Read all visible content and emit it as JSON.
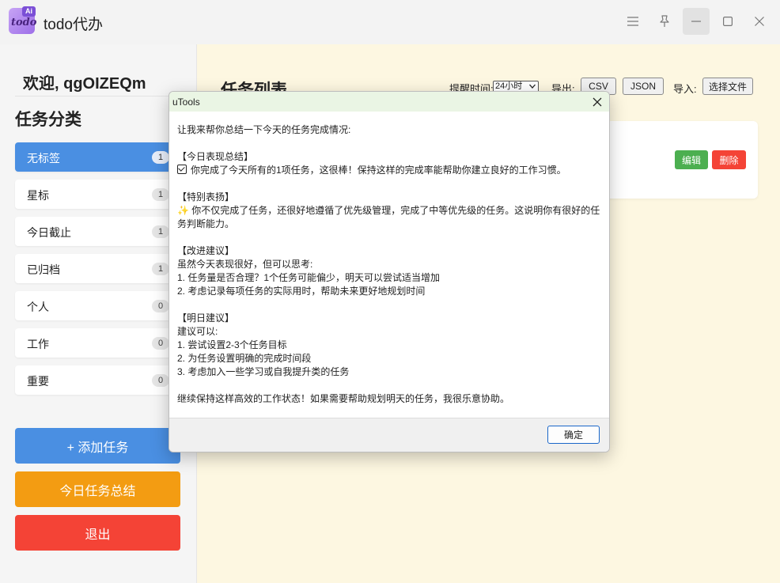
{
  "app": {
    "title": "todo代办",
    "logo_text": "todo",
    "logo_badge": "Ai",
    "window_controls": [
      "menu-icon",
      "pin-icon",
      "minimize-icon",
      "maximize-icon",
      "close-icon"
    ]
  },
  "sidebar": {
    "welcome": "欢迎, qgOIZEQm",
    "categories_heading": "任务分类",
    "categories": [
      {
        "label": "无标签",
        "count": "1",
        "active": true
      },
      {
        "label": "星标",
        "count": "1"
      },
      {
        "label": "今日截止",
        "count": "1"
      },
      {
        "label": "已归档",
        "count": "1"
      },
      {
        "label": "个人",
        "count": "0"
      },
      {
        "label": "工作",
        "count": "0"
      },
      {
        "label": "重要",
        "count": "0"
      }
    ],
    "add_task_label": "+ 添加任务",
    "summary_label": "今日任务总结",
    "logout_label": "退出",
    "colors": {
      "add": "#4a8fe2",
      "summary": "#f39c12",
      "logout": "#f44336",
      "active_category": "#4a8fe2"
    }
  },
  "main": {
    "title": "任务列表",
    "reminder_label": "提醒时间:",
    "reminder_value": "24小时",
    "export_label": "导出:",
    "export_csv": "CSV",
    "export_json": "JSON",
    "import_label": "导入:",
    "import_button": "选择文件",
    "task": {
      "edit_label": "编辑",
      "delete_label": "删除",
      "colors": {
        "edit": "#4caf50",
        "delete": "#f44336"
      }
    }
  },
  "dialog": {
    "title": "uTools",
    "lines": [
      {
        "text": "让我来帮你总结一下今天的任务完成情况:"
      },
      {
        "gap": true
      },
      {
        "text": "【今日表现总结】"
      },
      {
        "text": "你完成了今天所有的1项任务，这很棒！保持这样的完成率能帮助你建立良好的工作习惯。",
        "icon": "checkbox"
      },
      {
        "gap": true
      },
      {
        "text": "【特别表扬】"
      },
      {
        "text": "✨ 你不仅完成了任务，还很好地遵循了优先级管理，完成了中等优先级的任务。这说明你有很好的任务判断能力。",
        "wrap": true
      },
      {
        "gap": true
      },
      {
        "text": "【改进建议】"
      },
      {
        "text": "虽然今天表现很好，但可以思考:"
      },
      {
        "text": "1. 任务量是否合理？1个任务可能偏少，明天可以尝试适当增加"
      },
      {
        "text": "2. 考虑记录每项任务的实际用时，帮助未来更好地规划时间"
      },
      {
        "gap": true
      },
      {
        "text": "【明日建议】"
      },
      {
        "text": "建议可以:"
      },
      {
        "text": "1. 尝试设置2-3个任务目标"
      },
      {
        "text": "2. 为任务设置明确的完成时间段"
      },
      {
        "text": "3. 考虑加入一些学习或自我提升类的任务"
      },
      {
        "gap": true
      },
      {
        "text": "继续保持这样高效的工作状态！如果需要帮助规划明天的任务，我很乐意协助。"
      }
    ],
    "ok_label": "确定"
  }
}
